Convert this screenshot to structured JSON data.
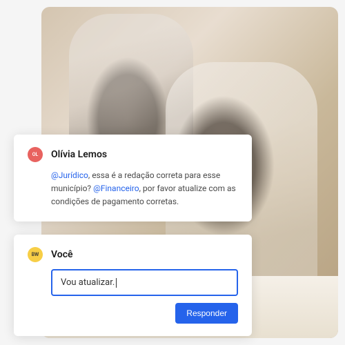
{
  "comments": [
    {
      "avatar_initials": "OL",
      "avatar_color": "red",
      "author": "Olívia Lemos",
      "body_parts": {
        "mention1": "@Jurídico",
        "text1": ", essa é a redação correta para esse município? ",
        "mention2": "@Financeiro",
        "text2": ", por favor atualize com as condições de pagamento corretas."
      }
    },
    {
      "avatar_initials": "BW",
      "avatar_color": "yellow",
      "author": "Você",
      "input_value": "Vou atualizar.",
      "reply_button": "Responder"
    }
  ]
}
